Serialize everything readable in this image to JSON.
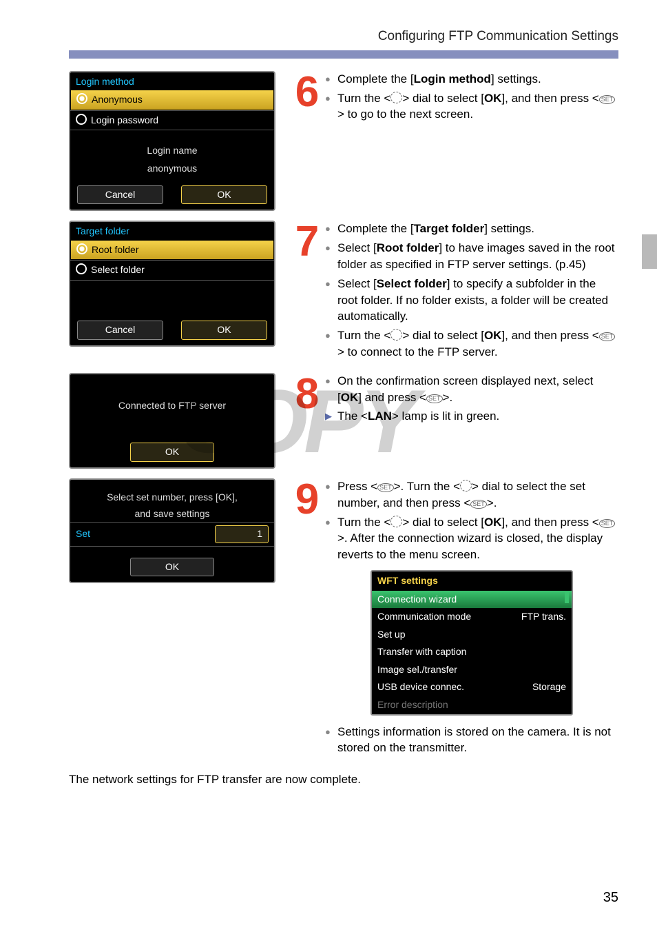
{
  "header": "Configuring FTP Communication Settings",
  "page_number": "35",
  "watermark": "COPY",
  "final_line": "The network settings for FTP transfer are now complete.",
  "steps": {
    "s6": {
      "num": "6",
      "shot": {
        "title": "Login method",
        "opt1": "Anonymous",
        "opt2": "Login password",
        "center1": "Login name",
        "center2": "anonymous",
        "cancel": "Cancel",
        "ok": "OK"
      },
      "b1a": "Complete the [",
      "b1b": "Login method",
      "b1c": "] settings.",
      "b2a": "Turn the <",
      "b2b": "> dial to select [",
      "b2c": "OK",
      "b2d": "], and then press <",
      "b2e": "> to go to the next screen."
    },
    "s7": {
      "num": "7",
      "shot": {
        "title": "Target folder",
        "opt1": "Root folder",
        "opt2": "Select folder",
        "cancel": "Cancel",
        "ok": "OK"
      },
      "b1a": "Complete the [",
      "b1b": "Target folder",
      "b1c": "] settings.",
      "b2a": "Select [",
      "b2b": "Root folder",
      "b2c": "] to have images saved in the root folder as specified in FTP server settings. (p.45)",
      "b3a": "Select [",
      "b3b": "Select folder",
      "b3c": "] to specify a subfolder in the root folder. If no folder exists, a folder will be created automatically.",
      "b4a": "Turn the <",
      "b4b": "> dial to select [",
      "b4c": "OK",
      "b4d": "], and then press <",
      "b4e": "> to connect to the FTP server."
    },
    "s8": {
      "num": "8",
      "shot": {
        "msg": "Connected to FTP server",
        "ok": "OK"
      },
      "b1a": "On the confirmation screen displayed next, select [",
      "b1b": "OK",
      "b1c": "] and press <",
      "b1d": ">.",
      "a1a": "The <",
      "a1b": "LAN",
      "a1c": "> lamp is lit in green."
    },
    "s9": {
      "num": "9",
      "shot": {
        "l1": "Select set number, press [OK],",
        "l2": "and save settings",
        "set": "Set",
        "val": "1",
        "ok": "OK"
      },
      "b1a": "Press <",
      "b1b": ">. Turn the <",
      "b1c": "> dial to select the set number, and then press <",
      "b1d": ">.",
      "b2a": "Turn the <",
      "b2b": "> dial to select [",
      "b2c": "OK",
      "b2d": "], and then press <",
      "b2e": ">. After the connection wizard is closed, the display reverts to the menu screen.",
      "menu": {
        "title": "WFT settings",
        "r1": "Connection wizard",
        "r2a": "Communication mode",
        "r2b": "FTP trans.",
        "r3": "Set up",
        "r4": "Transfer with caption",
        "r5": "Image sel./transfer",
        "r6a": "USB device connec.",
        "r6b": "Storage",
        "r7": "Error description"
      },
      "b3": "Settings information is stored on the camera. It is not stored on the transmitter."
    }
  }
}
